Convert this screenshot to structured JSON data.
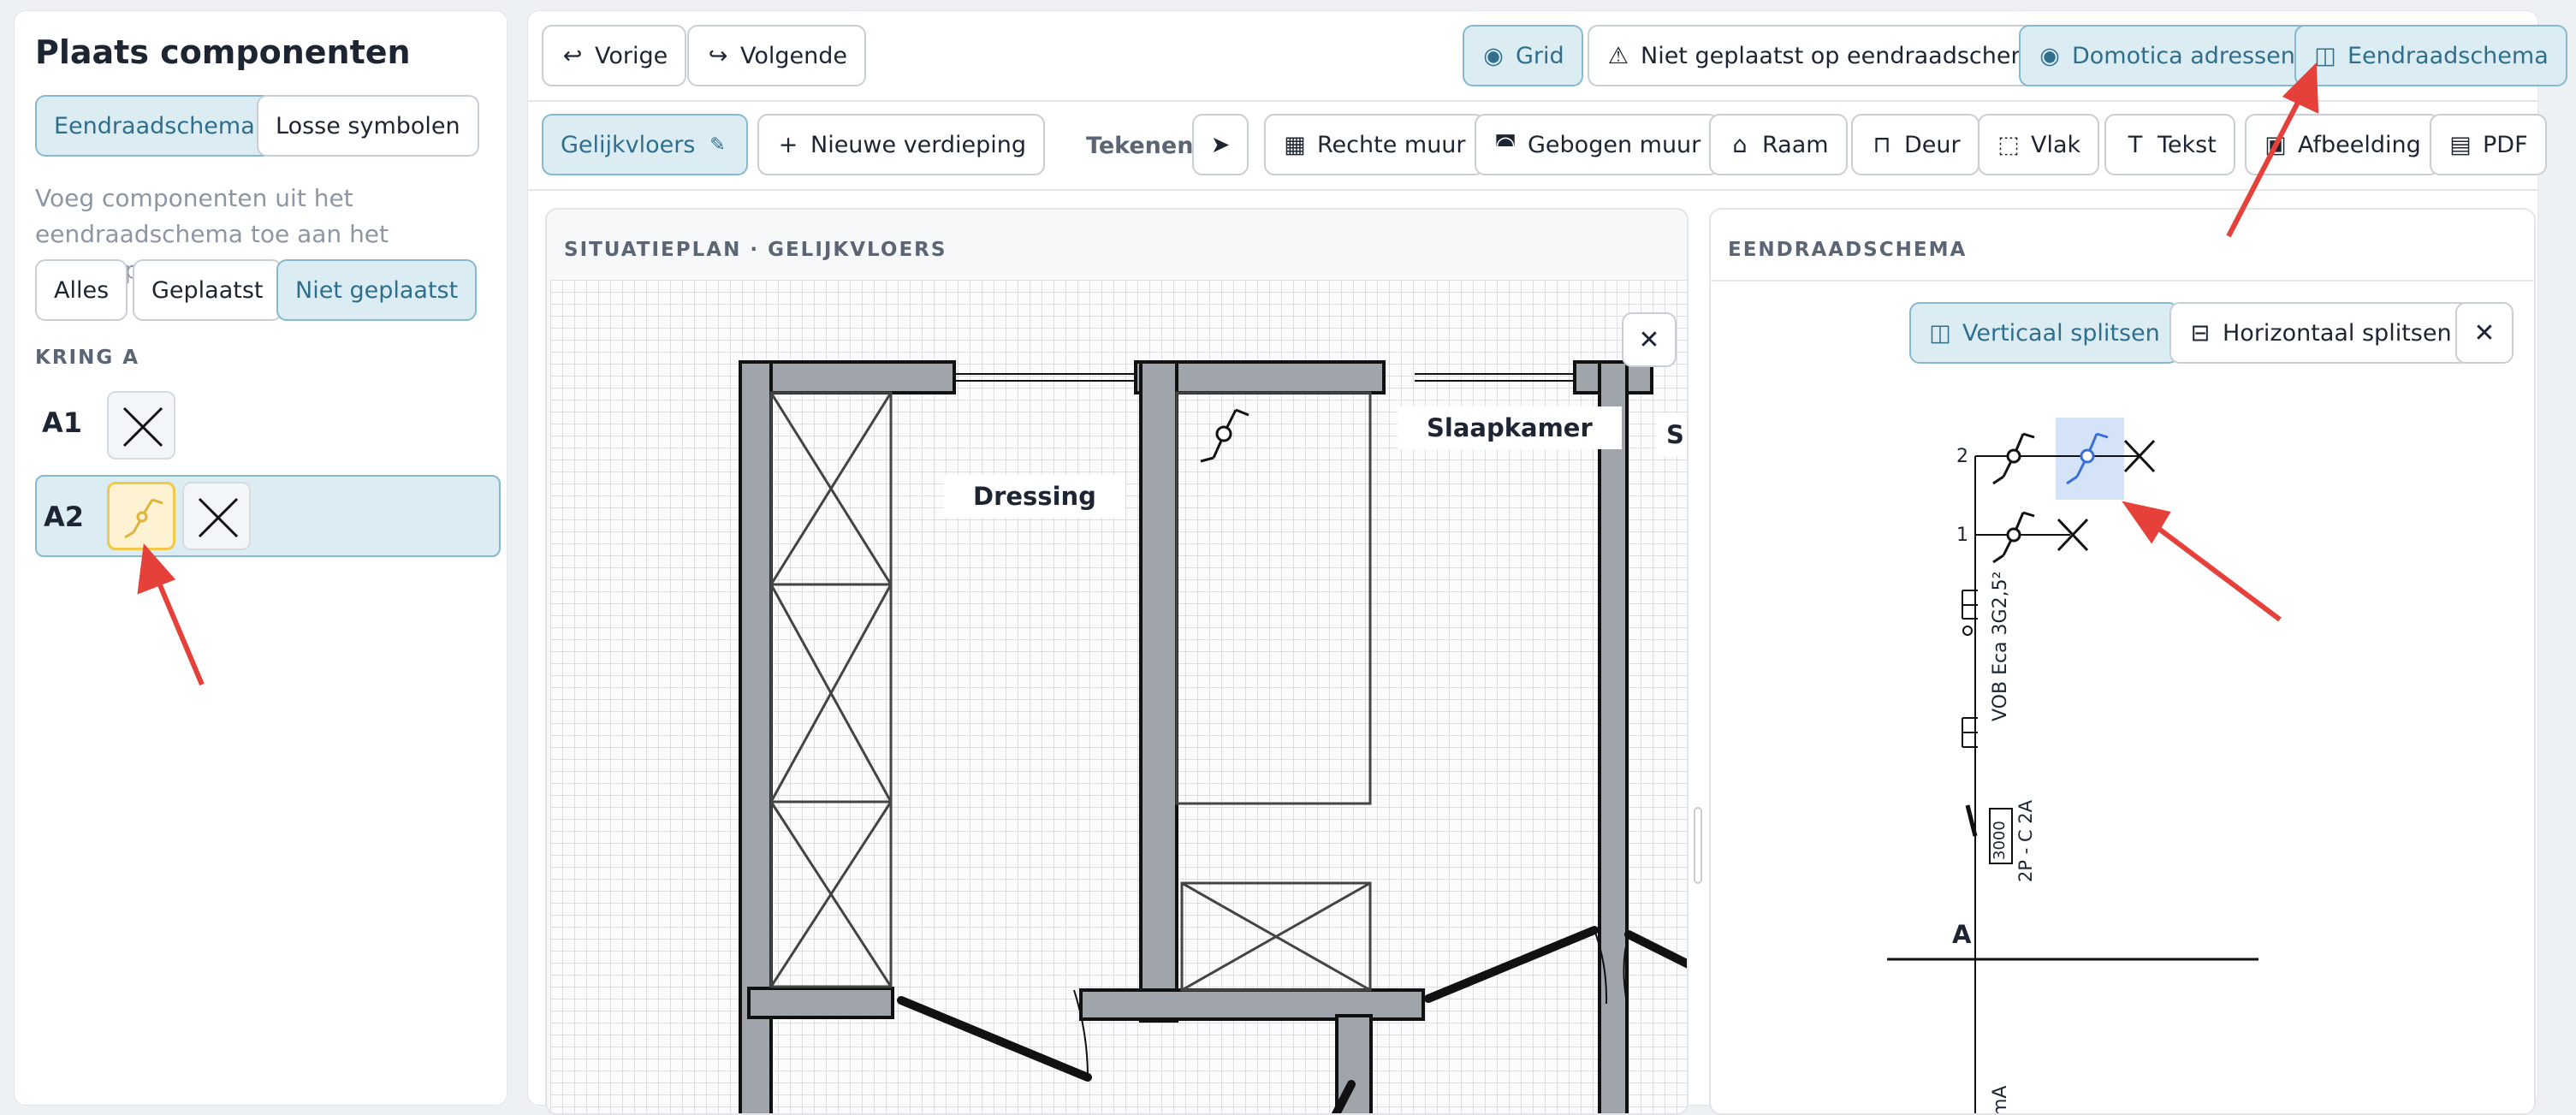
{
  "left": {
    "title": "Plaats componenten",
    "modes": [
      "Eendraadschema",
      "Losse symbolen"
    ],
    "description": "Voeg componenten uit het eendraadschema toe aan het situatieplan.",
    "filters": [
      "Alles",
      "Geplaatst",
      "Niet geplaatst"
    ],
    "group_label": "KRING A",
    "rows": [
      {
        "label": "A1"
      },
      {
        "label": "A2"
      }
    ]
  },
  "toolbar": {
    "prev": "Vorige",
    "next": "Volgende",
    "grid": "Grid",
    "not_placed": "Niet geplaatst op eendraadschema",
    "domotica": "Domotica adressen",
    "schema": "Eendraadschema"
  },
  "floorbar": {
    "floor": "Gelijkvloers",
    "new_floor": "Nieuwe verdieping",
    "draw_label": "Tekenen:",
    "tools": [
      "Rechte muur",
      "Gebogen muur",
      "Raam",
      "Deur",
      "Vlak",
      "Tekst",
      "Afbeelding",
      "PDF"
    ]
  },
  "plan": {
    "header": "SITUATIEPLAN · GELIJKVLOERS",
    "rooms": [
      "Dressing",
      "Slaapkamer",
      "S"
    ]
  },
  "schema": {
    "header": "EENDRAADSCHEMA",
    "split_vertical": "Verticaal splitsen",
    "split_horizontal": "Horizontaal splitsen",
    "circuit_numbers": [
      "2",
      "1"
    ],
    "cable": "VOB Eca 3G2,5²",
    "breaker_rating": "3000",
    "breaker": "2P - C 2A",
    "bus_label": "A",
    "bottom_partial": "mA"
  },
  "colors": {
    "accent": "#dcecf3",
    "accent_border": "#86b9cd",
    "highlight": "#fdf3d3",
    "annotation": "#e5403a",
    "wall": "#a0a4ab"
  }
}
